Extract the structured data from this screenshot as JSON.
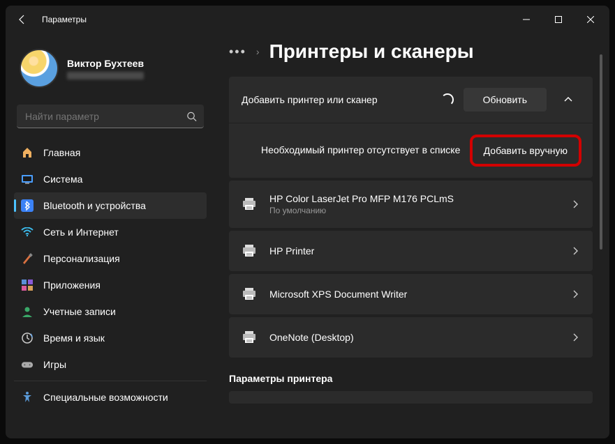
{
  "titlebar": {
    "title": "Параметры"
  },
  "profile": {
    "name": "Виктор Бухтеев"
  },
  "search": {
    "placeholder": "Найти параметр"
  },
  "sidebar": {
    "items": [
      {
        "label": "Главная",
        "icon": "home"
      },
      {
        "label": "Система",
        "icon": "system"
      },
      {
        "label": "Bluetooth и устройства",
        "icon": "bluetooth",
        "active": true
      },
      {
        "label": "Сеть и Интернет",
        "icon": "wifi"
      },
      {
        "label": "Персонализация",
        "icon": "brush"
      },
      {
        "label": "Приложения",
        "icon": "apps"
      },
      {
        "label": "Учетные записи",
        "icon": "account"
      },
      {
        "label": "Время и язык",
        "icon": "time"
      },
      {
        "label": "Игры",
        "icon": "game"
      },
      {
        "label": "Специальные возможности",
        "icon": "access"
      }
    ]
  },
  "breadcrumb": {
    "title": "Принтеры и сканеры"
  },
  "add": {
    "label": "Добавить принтер или сканер",
    "refresh": "Обновить",
    "missing": "Необходимый принтер отсутствует в списке",
    "manual": "Добавить вручную"
  },
  "printers": [
    {
      "name": "HP Color LaserJet Pro MFP M176 PCLmS",
      "sub": "По умолчанию"
    },
    {
      "name": "HP Printer",
      "sub": ""
    },
    {
      "name": "Microsoft XPS Document Writer",
      "sub": ""
    },
    {
      "name": "OneNote (Desktop)",
      "sub": ""
    }
  ],
  "section": {
    "title": "Параметры принтера"
  }
}
